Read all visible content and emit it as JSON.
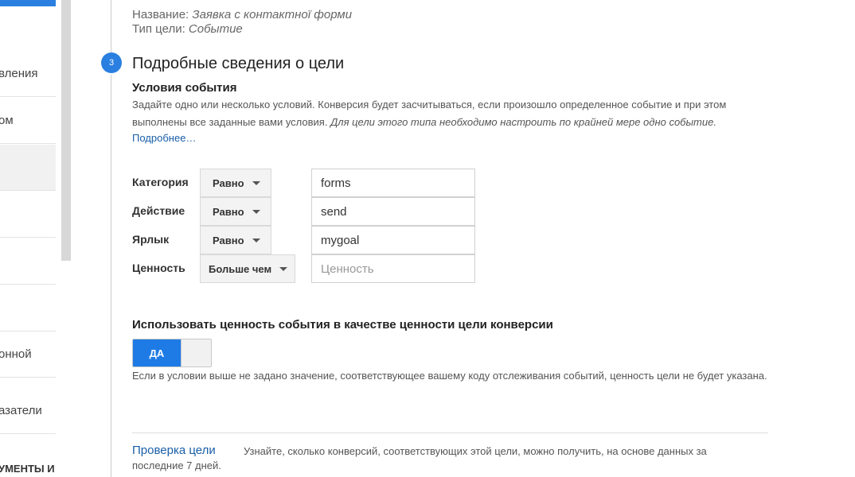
{
  "sidebar": {
    "items": [
      {
        "label": "вления"
      },
      {
        "label": "ом"
      },
      {
        "label": ""
      },
      {
        "label": ""
      },
      {
        "label": ""
      },
      {
        "label": ""
      },
      {
        "label": "онной"
      },
      {
        "label": "азатели"
      },
      {
        "label": "УМЕНТЫ И"
      }
    ]
  },
  "summary": {
    "name_label": "Название:",
    "name_value": "Заявка с контактної форми",
    "type_label": "Тип цели:",
    "type_value": "Событие"
  },
  "step": {
    "number": "3",
    "title": "Подробные сведения о цели"
  },
  "conditions": {
    "title": "Условия события",
    "desc_plain": "Задайте одно или несколько условий. Конверсия будет засчитываться, если произошло определенное событие и при этом выполнены все заданные вами условия.",
    "desc_italic": "Для цели этого типа необходимо настроить по крайней мере одно событие.",
    "more_link": "Подробнее…",
    "rows": [
      {
        "label": "Категория",
        "operator": "Равно",
        "value": "forms",
        "placeholder": ""
      },
      {
        "label": "Действие",
        "operator": "Равно",
        "value": "send",
        "placeholder": ""
      },
      {
        "label": "Ярлык",
        "operator": "Равно",
        "value": "mygoal",
        "placeholder": ""
      },
      {
        "label": "Ценность",
        "operator": "Больше чем",
        "value": "",
        "placeholder": "Ценность"
      }
    ]
  },
  "value_toggle": {
    "title": "Использовать ценность события в качестве ценности цели конверсии",
    "state_label": "ДА",
    "note": "Если в условии выше не задано значение, соответствующее вашему коду отслеживания событий, ценность цели не будет указана."
  },
  "verify": {
    "link": "Проверка цели",
    "text1": "Узнайте, сколько конверсий, соответствующих этой цели, можно получить, на основе данных за",
    "text2": "последние 7 дней."
  },
  "colors": {
    "accent": "#1e7be6",
    "link": "#1a5fa8"
  }
}
